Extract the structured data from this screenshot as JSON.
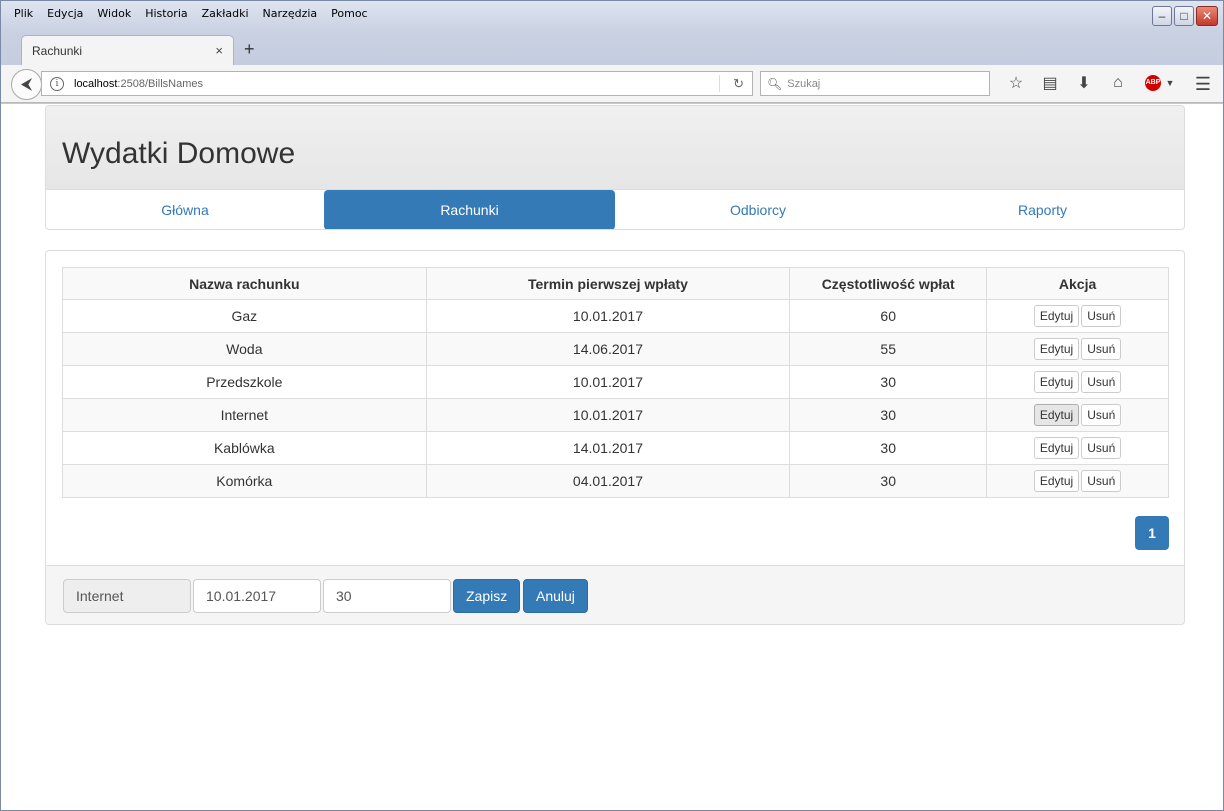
{
  "browser": {
    "menu": [
      "Plik",
      "Edycja",
      "Widok",
      "Historia",
      "Zakładki",
      "Narzędzia",
      "Pomoc"
    ],
    "tab_title": "Rachunki",
    "tab_close": "×",
    "new_tab": "+",
    "url_host": "localhost",
    "url_path": ":2508/BillsNames",
    "search_placeholder": "Szukaj",
    "abp_label": "ABP"
  },
  "app": {
    "title": "Wydatki Domowe",
    "nav": [
      "Główna",
      "Rachunki",
      "Odbiorcy",
      "Raporty"
    ],
    "active_nav": "Rachunki"
  },
  "table": {
    "headers": [
      "Nazwa rachunku",
      "Termin pierwszej wpłaty",
      "Częstotliwość wpłat",
      "Akcja"
    ],
    "rows": [
      {
        "name": "Gaz",
        "date": "10.01.2017",
        "freq": "60"
      },
      {
        "name": "Woda",
        "date": "14.06.2017",
        "freq": "55"
      },
      {
        "name": "Przedszkole",
        "date": "10.01.2017",
        "freq": "30"
      },
      {
        "name": "Internet",
        "date": "10.01.2017",
        "freq": "30"
      },
      {
        "name": "Kablówka",
        "date": "14.01.2017",
        "freq": "30"
      },
      {
        "name": "Komórka",
        "date": "04.01.2017",
        "freq": "30"
      }
    ],
    "edit_label": "Edytuj",
    "delete_label": "Usuń"
  },
  "pagination": {
    "current_page": "1"
  },
  "form": {
    "name_value": "Internet",
    "date_value": "10.01.2017",
    "freq_value": "30",
    "save_label": "Zapisz",
    "cancel_label": "Anuluj"
  },
  "colors": {
    "primary": "#337ab7"
  }
}
